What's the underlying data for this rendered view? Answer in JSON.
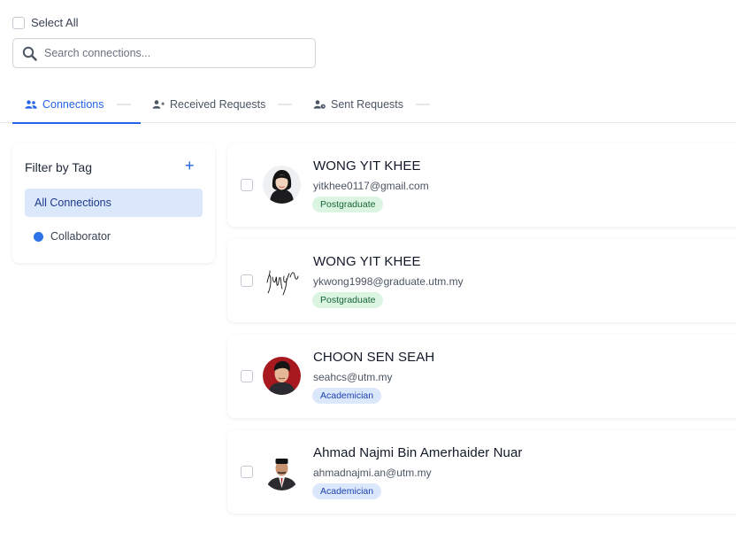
{
  "select_all_label": "Select All",
  "search": {
    "placeholder": "Search connections..."
  },
  "tabs": [
    {
      "label": "Connections",
      "icon": "users-icon",
      "active": true
    },
    {
      "label": "Received Requests",
      "icon": "user-plus-icon",
      "active": false
    },
    {
      "label": "Sent Requests",
      "icon": "user-clock-icon",
      "active": false
    }
  ],
  "filter": {
    "title": "Filter by Tag",
    "add_symbol": "+",
    "items": [
      {
        "label": "All Connections",
        "selected": true
      },
      {
        "label": "Collaborator",
        "color": "#2f73e8"
      }
    ]
  },
  "connections": [
    {
      "name": "WONG YIT KHEE",
      "email": "yitkhee0117@gmail.com",
      "tag": "Postgraduate",
      "avatar": "woman-portrait"
    },
    {
      "name": "WONG YIT KHEE",
      "email": "ykwong1998@graduate.utm.my",
      "tag": "Postgraduate",
      "avatar": "signature"
    },
    {
      "name": "CHOON SEN SEAH",
      "email": "seahcs@utm.my",
      "tag": "Academician",
      "avatar": "man-portrait-red"
    },
    {
      "name": "Ahmad Najmi Bin Amerhaider Nuar",
      "email": "ahmadnajmi.an@utm.my",
      "tag": "Academician",
      "avatar": "man-portrait-suit"
    }
  ],
  "colors": {
    "accent": "#2563eb",
    "postgraduate_bg": "#dcf5e3",
    "academician_bg": "#dbe8fb"
  }
}
